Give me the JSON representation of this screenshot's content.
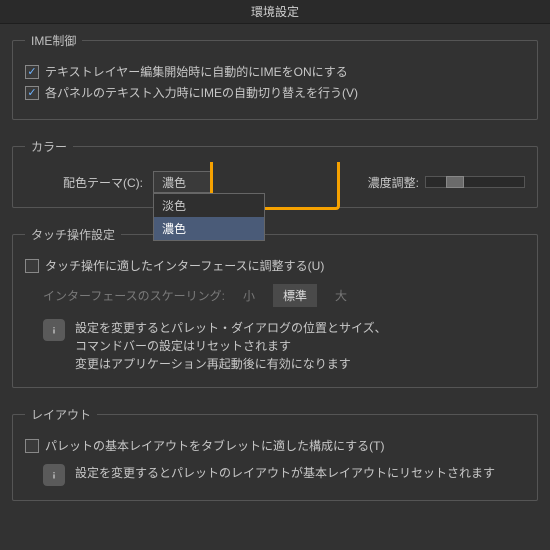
{
  "window": {
    "title": "環境設定"
  },
  "ime": {
    "legend": "IME制御",
    "opt1": "テキストレイヤー編集開始時に自動的にIMEをONにする",
    "opt2": "各パネルのテキスト入力時にIMEの自動切り替えを行う(V)"
  },
  "color": {
    "legend": "カラー",
    "theme_label": "配色テーマ(C):",
    "selected": "濃色",
    "options": {
      "o1": "淡色",
      "o2": "濃色"
    },
    "density_label": "濃度調整:"
  },
  "touch": {
    "legend": "タッチ操作設定",
    "opt1": "タッチ操作に適したインターフェースに調整する(U)",
    "scale_label": "インターフェースのスケーリング:",
    "scale_s": "小",
    "scale_m": "標準",
    "scale_l": "大",
    "note1": "設定を変更するとパレット・ダイアログの位置とサイズ、",
    "note2": "コマンドバーの設定はリセットされます",
    "note3": "変更はアプリケーション再起動後に有効になります"
  },
  "layout": {
    "legend": "レイアウト",
    "opt1": "パレットの基本レイアウトをタブレットに適した構成にする(T)",
    "note": "設定を変更するとパレットのレイアウトが基本レイアウトにリセットされます"
  }
}
